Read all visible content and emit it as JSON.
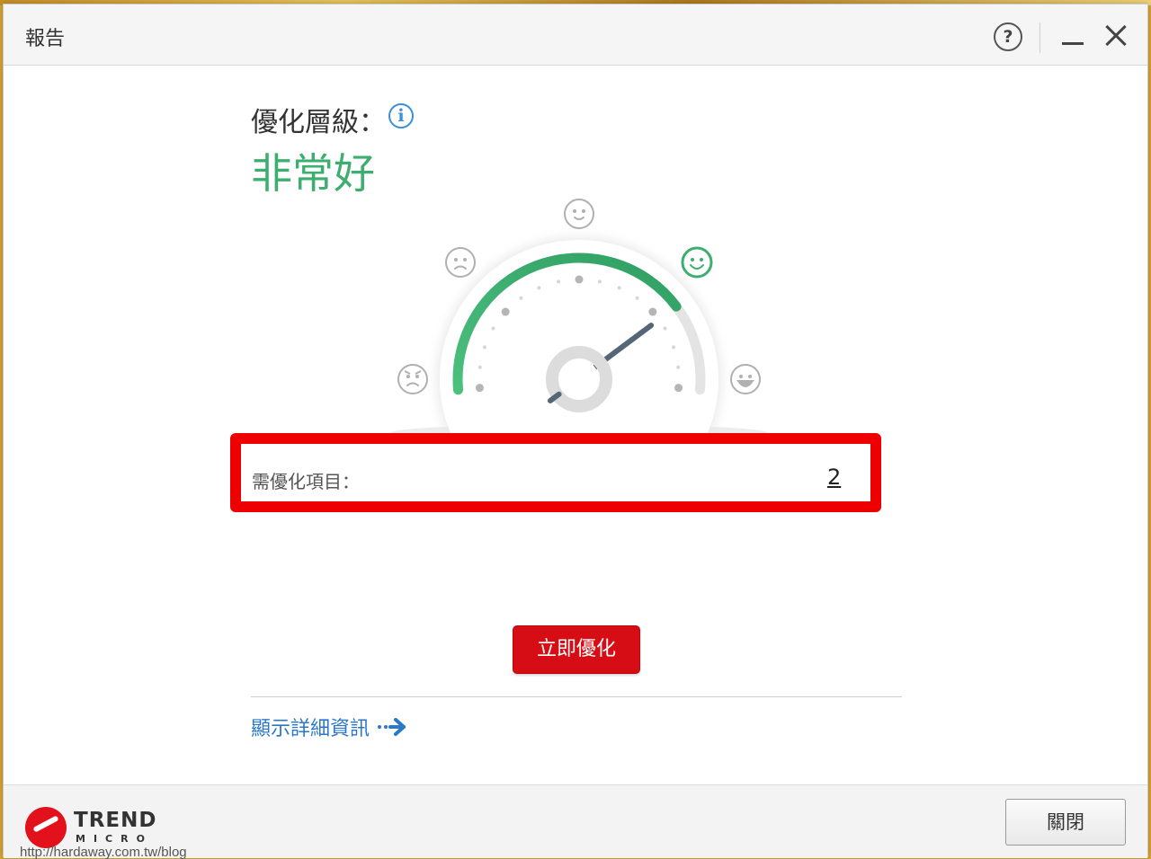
{
  "window": {
    "title": "報告"
  },
  "titlebar": {
    "help_symbol": "?"
  },
  "report": {
    "level_label": "優化層級：",
    "level_value": "非常好",
    "info_symbol": "i",
    "items_label": "需優化項目：",
    "items_count": "2",
    "fix_button": "立即優化",
    "details_link": "顯示詳細資訊"
  },
  "gauge": {
    "level_fraction": 0.78,
    "faces": [
      "angry-face-icon",
      "sad-face-icon",
      "neutral-face-icon",
      "happy-face-icon",
      "grinning-face-icon"
    ],
    "active_face": "happy-face-icon",
    "colors": {
      "good": "#3dae6f",
      "track": "#e4e4e4",
      "needle": "#556677"
    }
  },
  "footer": {
    "brand_top": "TREND",
    "brand_bottom": "MICRO",
    "watermark": "http://hardaway.com.tw/blog",
    "close_button": "關閉"
  },
  "colors": {
    "accent_red": "#d60d14",
    "highlight_red": "#ee0000",
    "link_blue": "#2b78c8"
  }
}
